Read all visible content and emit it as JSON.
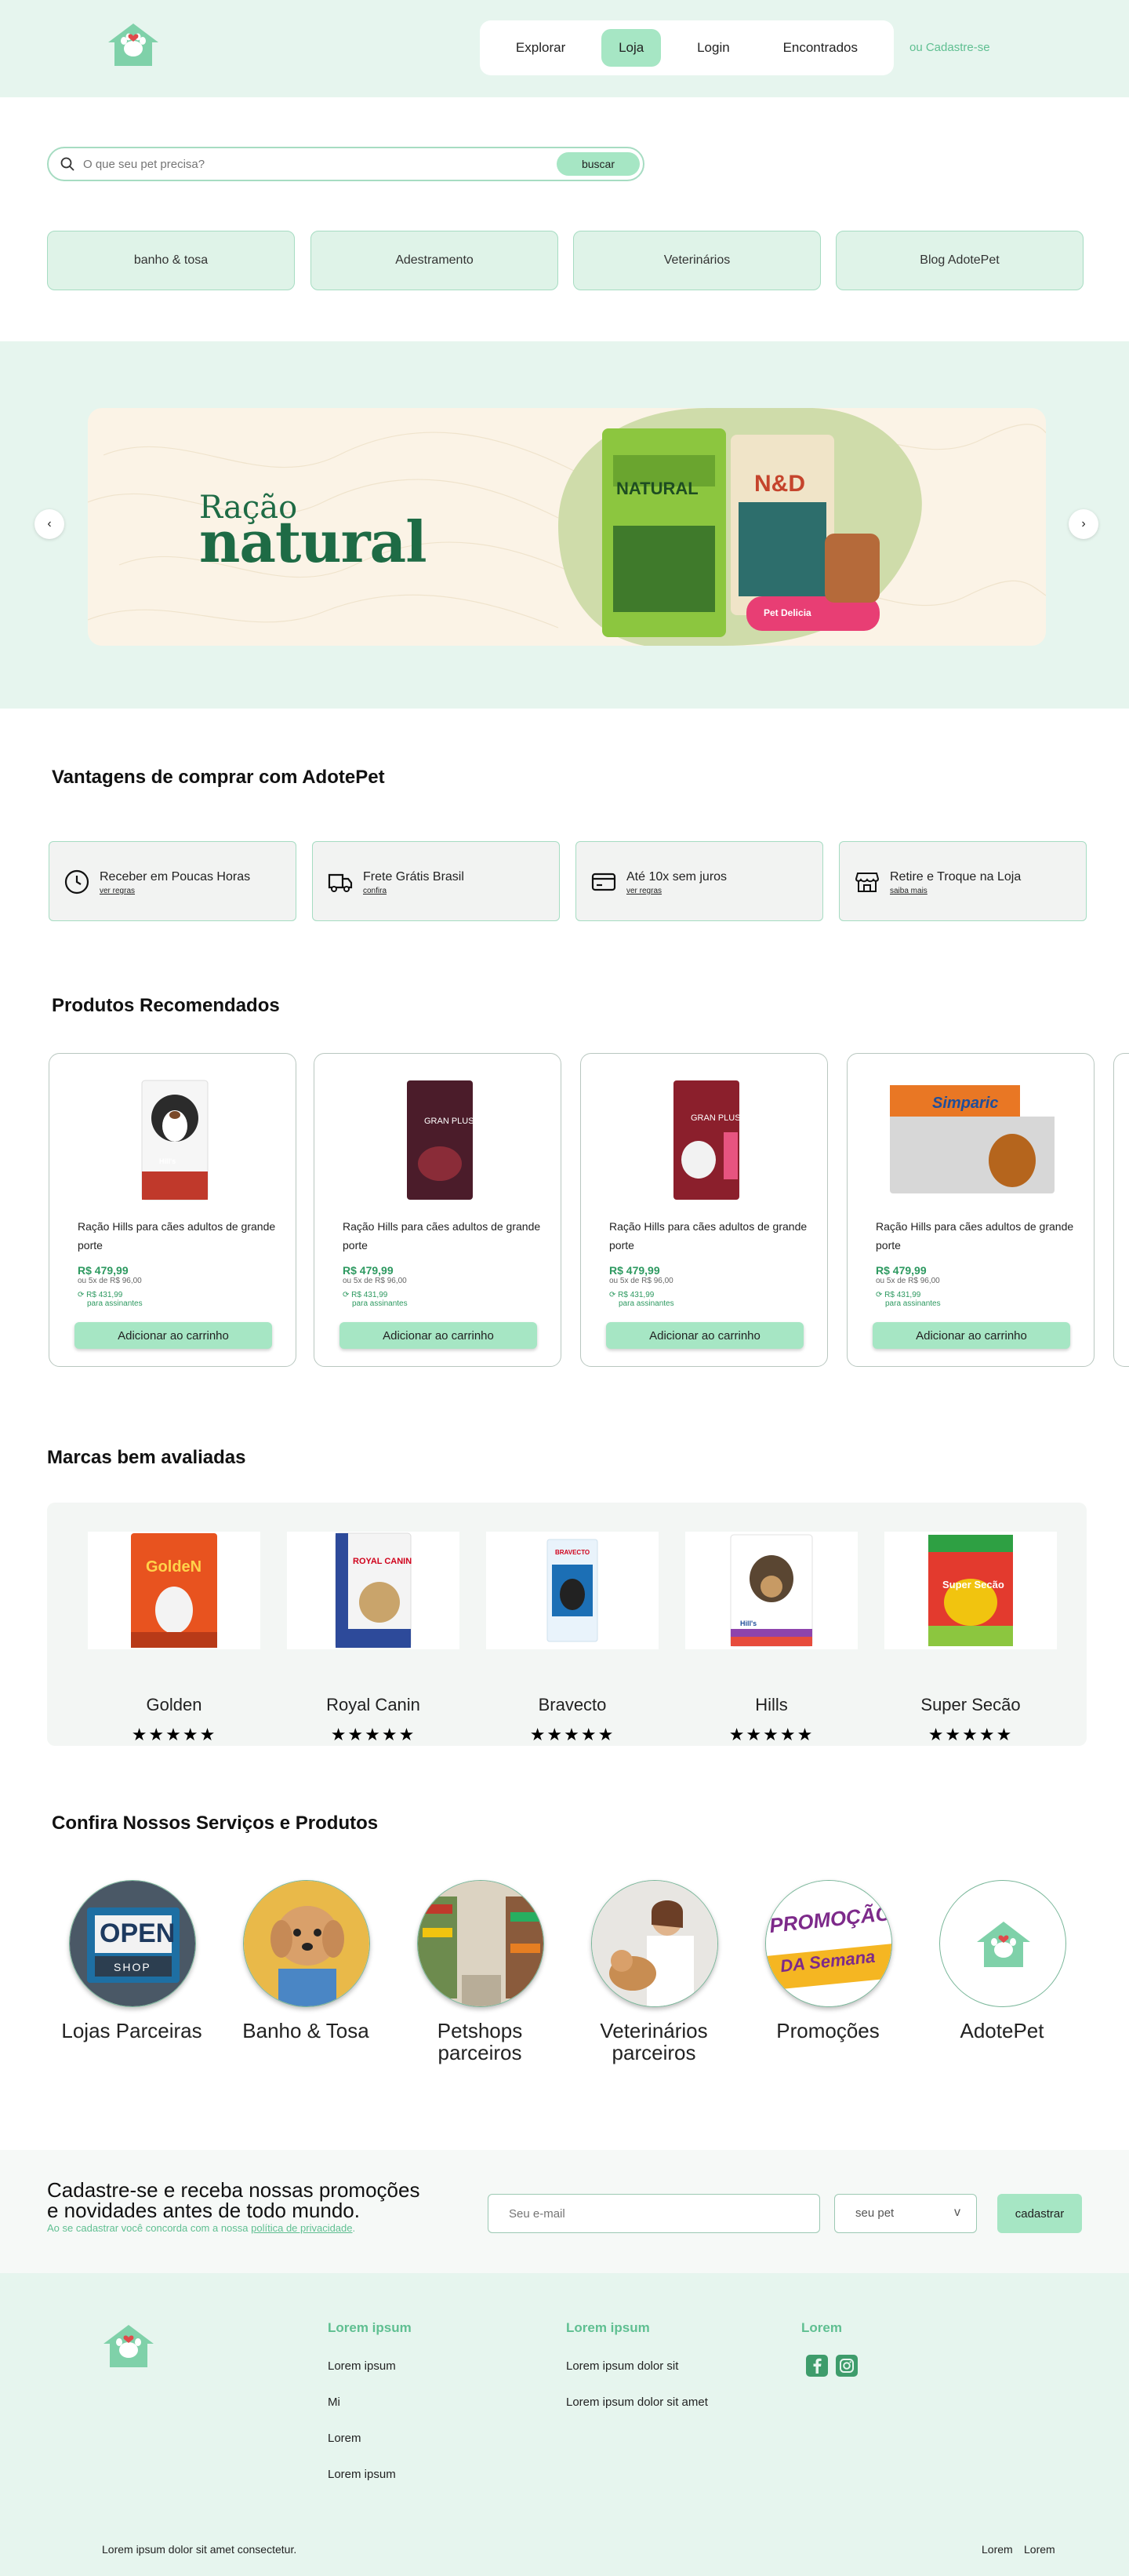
{
  "header": {
    "nav": [
      "Explorar",
      "Loja",
      "Login",
      "Encontrados"
    ],
    "active_nav": "Loja",
    "signup_link": "ou Cadastre-se"
  },
  "search": {
    "placeholder": "O que seu pet precisa?",
    "button_label": "buscar"
  },
  "categories": [
    "banho & tosa",
    "Adestramento",
    "Veterinários",
    "Blog AdotePet"
  ],
  "banner": {
    "subtitle": "Ração",
    "title": "natural",
    "products": [
      "NATURAL",
      "N&D",
      "Pet Delicia"
    ]
  },
  "advantages": {
    "title": "Vantagens de comprar com AdotePet",
    "items": [
      {
        "icon": "clock-icon",
        "title": "Receber em Poucas Horas",
        "link": "ver regras"
      },
      {
        "icon": "truck-icon",
        "title": "Frete Grátis Brasil",
        "link": "confira"
      },
      {
        "icon": "credit-card-icon",
        "title": "Até 10x sem juros",
        "link": "ver regras"
      },
      {
        "icon": "store-icon",
        "title": "Retire e Troque na Loja",
        "link": "saiba mais"
      }
    ]
  },
  "products": {
    "title": "Produtos Recomendados",
    "items": [
      {
        "name": "Ração Hills para cães adultos de grande porte",
        "price": "R$ 479,99",
        "installments": "ou 5x de R$ 96,00",
        "club_price": "R$ 431,99",
        "club_label": "para assinantes",
        "button": "Adicionar ao carrinho",
        "package_label": "Hill's"
      },
      {
        "name": "Ração Hills para cães adultos de grande porte",
        "price": "R$ 479,99",
        "installments": "ou 5x de R$ 96,00",
        "club_price": "R$ 431,99",
        "club_label": "para assinantes",
        "button": "Adicionar ao carrinho",
        "package_label": "GRAN PLUS"
      },
      {
        "name": "Ração Hills para cães adultos de grande porte",
        "price": "R$ 479,99",
        "installments": "ou 5x de R$ 96,00",
        "club_price": "R$ 431,99",
        "club_label": "para assinantes",
        "button": "Adicionar ao carrinho",
        "package_label": "GRAN PLUS"
      },
      {
        "name": "Ração Hills para cães adultos de grande porte",
        "price": "R$ 479,99",
        "installments": "ou 5x de R$ 96,00",
        "club_price": "R$ 431,99",
        "club_label": "para assinantes",
        "button": "Adicionar ao carrinho",
        "package_label": "Simparic"
      }
    ]
  },
  "brands": {
    "title": "Marcas bem avaliadas",
    "items": [
      {
        "name": "Golden",
        "stars": "★★★★★",
        "package_label": "GoldeN",
        "color": "#e8531f"
      },
      {
        "name": "Royal Canin",
        "stars": "★★★★★",
        "package_label": "ROYAL CANIN",
        "color": "#f4f4f4"
      },
      {
        "name": "Bravecto",
        "stars": "★★★★★",
        "package_label": "BRAVECTO",
        "color": "#e9f3fb"
      },
      {
        "name": "Hills",
        "stars": "★★★★★",
        "package_label": "Hill's",
        "color": "#ffffff"
      },
      {
        "name": "Super Secão",
        "stars": "★★★★★",
        "package_label": "Super Secão",
        "color": "#e33a2e"
      }
    ]
  },
  "services": {
    "title": "Confira Nossos Serviços e Produtos",
    "items": [
      {
        "label": "Lojas Parceiras",
        "picture_text": "OPEN",
        "picture_subtext": "SHOP"
      },
      {
        "label": "Banho & Tosa",
        "picture_text": "",
        "picture_subtext": ""
      },
      {
        "label": "Petshops parceiros",
        "picture_text": "",
        "picture_subtext": ""
      },
      {
        "label": "Veterinários parceiros",
        "picture_text": "",
        "picture_subtext": ""
      },
      {
        "label": "Promoções",
        "picture_text": "PROMOÇÃO",
        "picture_subtext": "DA Semana"
      },
      {
        "label": "AdotePet",
        "picture_text": "",
        "picture_subtext": ""
      }
    ]
  },
  "newsletter": {
    "heading_line1": "Cadastre-se e receba nossas promoções",
    "heading_line2": "e novidades antes de todo mundo.",
    "note_prefix": "Ao se cadastrar você concorda com a nossa ",
    "note_link": "política de privacidade",
    "note_suffix": ".",
    "email_placeholder": "Seu e-mail",
    "pet_select": "seu pet",
    "pet_chevron": "v",
    "button": "cadastrar"
  },
  "footer": {
    "col1_title": "Lorem ipsum",
    "col1_links": [
      "Lorem ipsum",
      "Mi",
      "Lorem",
      "Lorem ipsum"
    ],
    "col2_title": "Lorem ipsum",
    "col2_links": [
      "Lorem ipsum dolor sit",
      "Lorem ipsum dolor sit amet"
    ],
    "col3_title": "Lorem",
    "copyright": "Lorem ipsum dolor sit amet consectetur.",
    "bottom_links": [
      "Lorem",
      "Lorem"
    ]
  },
  "colors": {
    "mint_bg": "#e6f5ee",
    "accent": "#a6e6c4",
    "green_text": "#5fbf91",
    "brand_green": "#1e6b45"
  }
}
